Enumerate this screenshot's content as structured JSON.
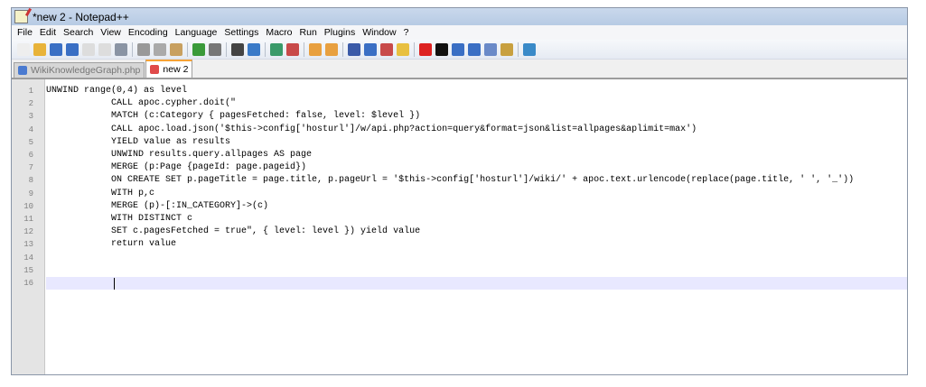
{
  "title": "*new  2 - Notepad++",
  "menu": [
    "File",
    "Edit",
    "Search",
    "View",
    "Encoding",
    "Language",
    "Settings",
    "Macro",
    "Run",
    "Plugins",
    "Window",
    "?"
  ],
  "toolbar_icons": [
    "new-file",
    "open-file",
    "save",
    "save-all",
    "close",
    "close-all",
    "print",
    "cut",
    "copy",
    "paste",
    "undo",
    "redo",
    "find",
    "replace",
    "zoom-in",
    "zoom-out",
    "sync-vertical",
    "sync-horizontal",
    "word-wrap",
    "show-all-chars",
    "indent-guide",
    "user-lang",
    "record-macro",
    "stop-record",
    "play-macro",
    "run-macro-multiple",
    "save-macro",
    "folder-as-workspace",
    "spell-check"
  ],
  "tabs": [
    {
      "label": "WikiKnowledgeGraph.php",
      "active": false
    },
    {
      "label": "new  2",
      "active": true
    }
  ],
  "current_line": 16,
  "lines": [
    "UNWIND range(0,4) as level",
    "            CALL apoc.cypher.doit(\"",
    "            MATCH (c:Category { pagesFetched: false, level: $level })",
    "            CALL apoc.load.json('$this->config['hosturl']/w/api.php?action=query&format=json&list=allpages&aplimit=max')",
    "            YIELD value as results",
    "            UNWIND results.query.allpages AS page",
    "            MERGE (p:Page {pageId: page.pageid})",
    "            ON CREATE SET p.pageTitle = page.title, p.pageUrl = '$this->config['hosturl']/wiki/' + apoc.text.urlencode(replace(page.title, ' ', '_'))",
    "            WITH p,c",
    "            MERGE (p)-[:IN_CATEGORY]->(c)",
    "            WITH DISTINCT c",
    "            SET c.pagesFetched = true\", { level: level }) yield value",
    "            return value",
    "",
    "",
    ""
  ]
}
